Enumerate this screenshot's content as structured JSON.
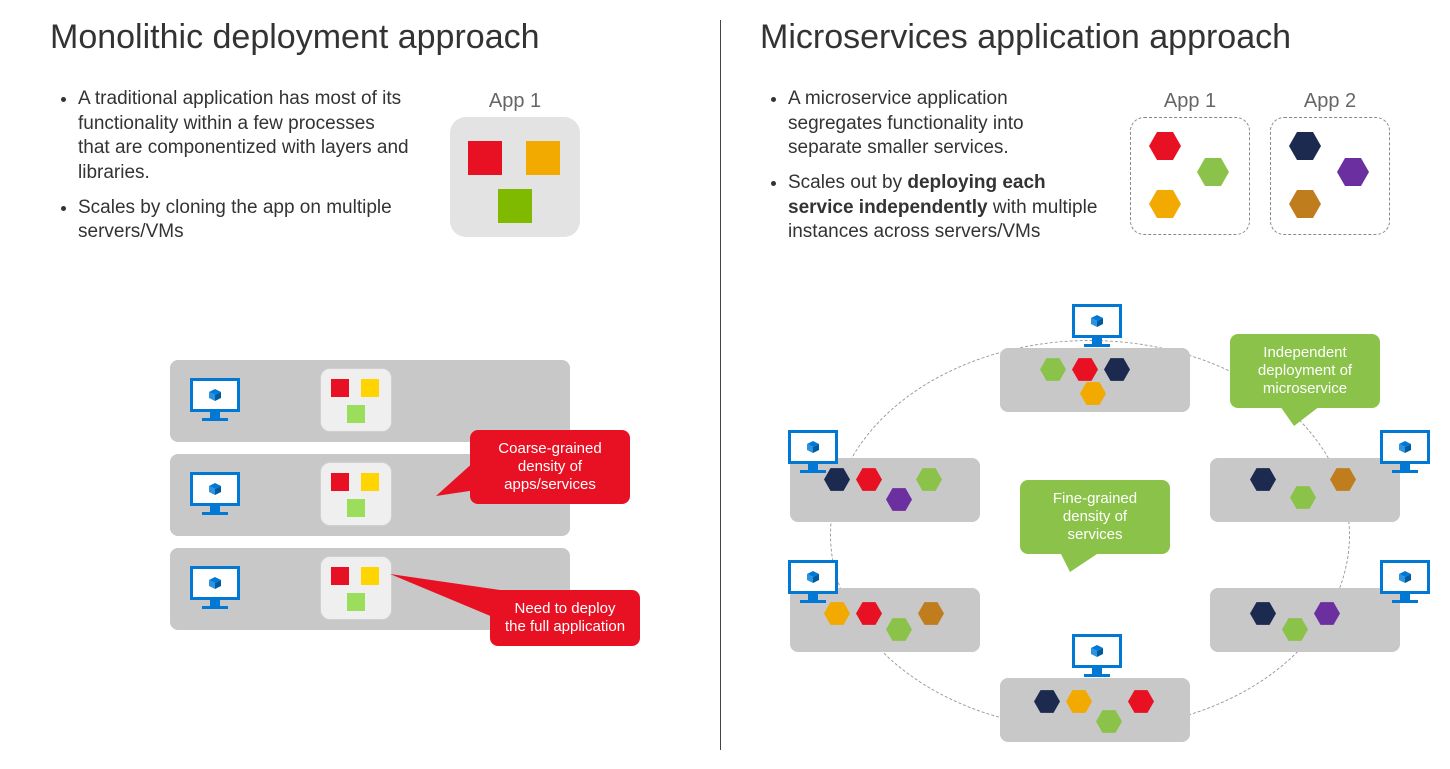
{
  "left": {
    "title": "Monolithic deployment approach",
    "bullets": [
      "A traditional application has most of its functionality within a few processes that are componentized with layers and libraries.",
      "Scales by cloning the app on multiple servers/VMs"
    ],
    "app1_label": "App 1",
    "callout1": "Coarse-grained density of apps/services",
    "callout2": "Need to deploy the full application"
  },
  "right": {
    "title": "Microservices application approach",
    "bullet1": "A microservice application segregates functionality into separate smaller services.",
    "bullet2_pre": "Scales out by ",
    "bullet2_bold": "deploying each service independently",
    "bullet2_post": " with multiple instances across servers/VMs",
    "app1_label": "App 1",
    "app2_label": "App 2",
    "callout_green": "Fine-grained density of services",
    "callout_indep": "Independent deployment of microservice"
  },
  "colors": {
    "red": "#e81123",
    "orange": "#f2a900",
    "lime": "#8bc34a",
    "navy": "#1b2a4e",
    "purple": "#6b2fa0",
    "brown": "#c07d1e"
  }
}
